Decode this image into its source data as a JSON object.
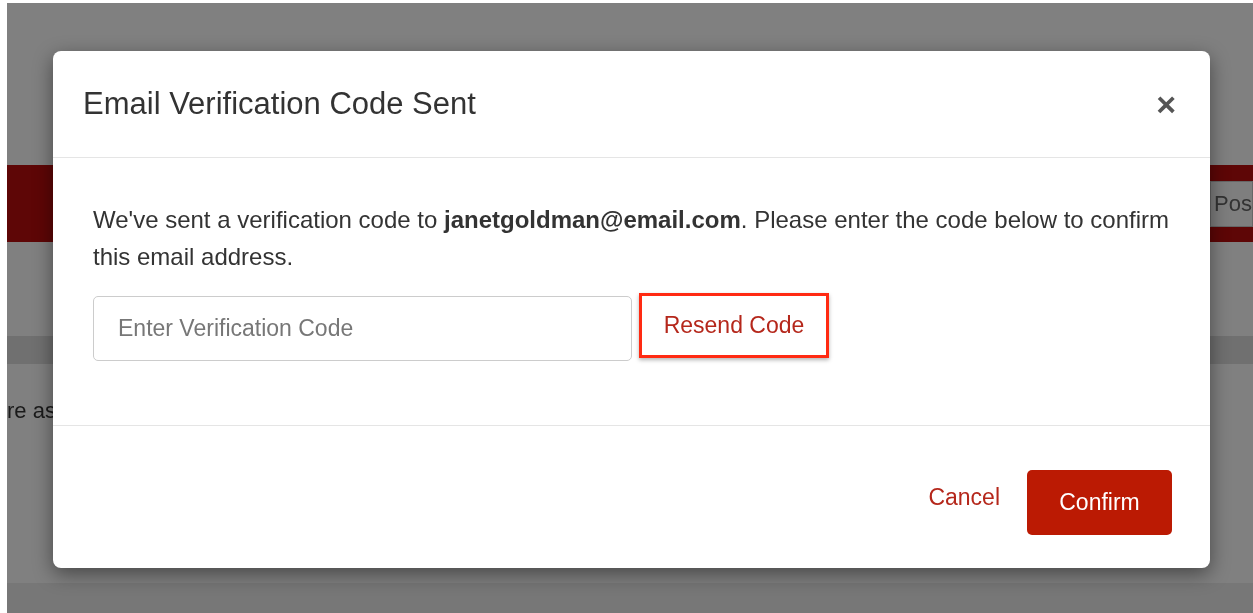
{
  "background": {
    "button_label": "Pos",
    "text": "re as"
  },
  "dialog": {
    "title": "Email Verification Code Sent",
    "close": "×",
    "message": "We've sent a verification code to **janetgoldman@email.com**. Please enter the code below to confirm this email address.",
    "code_field": {
      "placeholder": "Enter Verification Code"
    },
    "resend_link": {
      "label": "Resend Code",
      "highlighted": true
    },
    "buttons": [
      {
        "kind": "link",
        "label": "Cancel"
      },
      {
        "kind": "primary",
        "label": "Confirm"
      }
    ]
  }
}
